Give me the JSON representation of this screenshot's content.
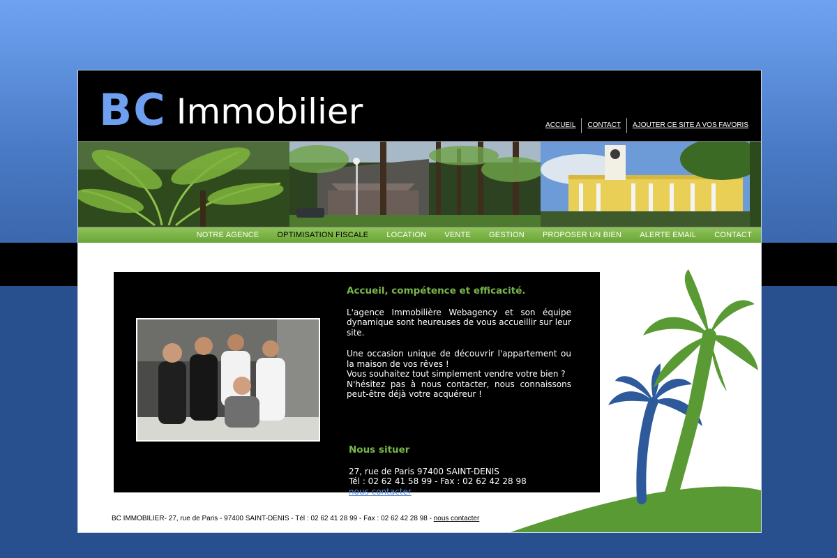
{
  "logo": {
    "bc": "BC",
    "name": "Immobilier"
  },
  "toplinks": [
    "ACCUEIL",
    "CONTACT",
    "AJOUTER CE SITE A VOS FAVORIS"
  ],
  "nav": [
    {
      "label": "NOTRE AGENCE",
      "active": false
    },
    {
      "label": "OPTIMISATION FISCALE",
      "active": true
    },
    {
      "label": "LOCATION",
      "active": false
    },
    {
      "label": "VENTE",
      "active": false
    },
    {
      "label": "GESTION",
      "active": false
    },
    {
      "label": "PROPOSER UN BIEN",
      "active": false
    },
    {
      "label": "ALERTE EMAIL",
      "active": false
    },
    {
      "label": "CONTACT",
      "active": false
    }
  ],
  "welcome": {
    "title": "Accueil, compétence et efficacité.",
    "p1": "L'agence Immobilière Webagency et son équipe dynamique sont heureuses de vous accueillir sur leur site.",
    "p2a": "Une occasion unique de découvrir l'appartement ou la maison de vos rêves !",
    "p2b": "Vous souhaitez tout simplement vendre votre bien ?",
    "p2c": "N'hésitez pas à nous contacter, nous connaissons peut-être déjà votre acquéreur !"
  },
  "locate": {
    "title": "Nous situer",
    "address": "27, rue de Paris 97400 SAINT-DENIS",
    "phones": "Tél : 02 62 41 58 99 - Fax : 02 62 42 28 98",
    "link": "nous contacter"
  },
  "footer": {
    "text": "BC IMMOBILIER- 27, rue de Paris - 97400 SAINT-DENIS - Tél : 02 62 41 28 99 - Fax : 02 62 42 28 98 - ",
    "link": "nous contacter"
  },
  "colors": {
    "page_blue": "#28508f",
    "logo_blue": "#6f9ff0",
    "nav_green": "#6aa536",
    "heading_green": "#78b84a",
    "link_blue": "#5b8ad8",
    "palm_green": "#5a9a34",
    "palm_blue": "#2e5a9c"
  }
}
